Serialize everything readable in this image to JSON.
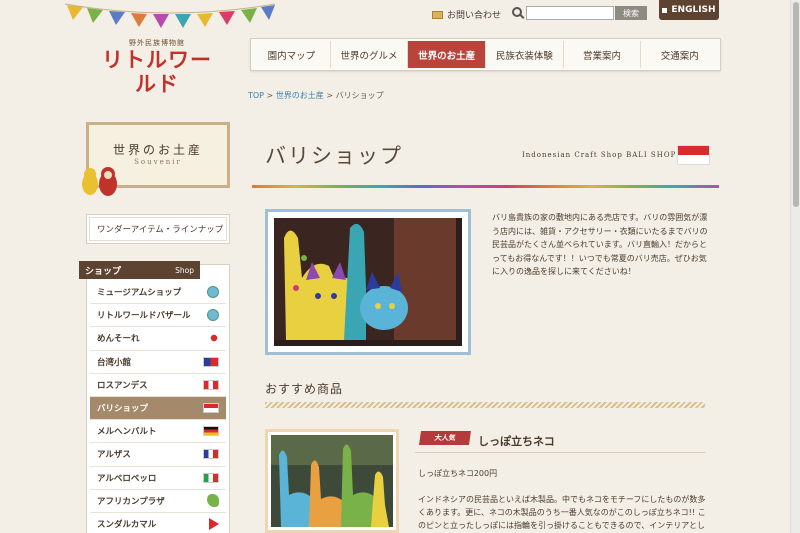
{
  "logo": {
    "sub": "野外民族博物館",
    "main": "リトルワールド"
  },
  "utility": {
    "contact_label": "お問い合わせ",
    "search_placeholder": "",
    "search_button": "検索",
    "english_label": "ENGLISH"
  },
  "nav": {
    "items": [
      {
        "label": "園内マップ"
      },
      {
        "label": "世界のグルメ"
      },
      {
        "label": "世界のお土産"
      },
      {
        "label": "民族衣装体験"
      },
      {
        "label": "営業案内"
      },
      {
        "label": "交通案内"
      }
    ],
    "active_index": 2
  },
  "breadcrumb": {
    "top": "TOP",
    "sep1": " > ",
    "parent": "世界のお土産",
    "sep2": " > ",
    "current": "バリショップ"
  },
  "sidebar": {
    "souvenir_jp": "世界のお土産",
    "souvenir_en": "Souvenir",
    "lineup_label": "ワンダーアイテム・ラインナップ",
    "shop_heading": "ショップ",
    "shop_heading_en": "Shop",
    "shops": [
      {
        "label": "ミュージアムショップ",
        "icon": "globe-icon"
      },
      {
        "label": "リトルワールドバザール",
        "icon": "globe-icon"
      },
      {
        "label": "めんそーれ",
        "icon": "flag-japan-icon"
      },
      {
        "label": "台湾小館",
        "icon": "flag-taiwan-icon"
      },
      {
        "label": "ロスアンデス",
        "icon": "flag-peru-icon"
      },
      {
        "label": "バリショップ",
        "icon": "flag-indonesia-icon",
        "active": true
      },
      {
        "label": "メルヘンバルト",
        "icon": "flag-germany-icon"
      },
      {
        "label": "アルザス",
        "icon": "flag-france-icon"
      },
      {
        "label": "アルベロベッロ",
        "icon": "flag-italy-icon"
      },
      {
        "label": "アフリカンプラザ",
        "icon": "africa-map-icon"
      },
      {
        "label": "スンダルカマル",
        "icon": "flag-nepal-icon"
      }
    ]
  },
  "main": {
    "title": "バリショップ",
    "subtitle": "Indonesian Craft Shop BALI SHOP",
    "intro": "バリ島貴族の家の敷地内にある売店です。バリの雰囲気が漂う店内には、雑貨・アクセサリー・衣類にいたるまでバリの民芸品がたくさん並べられています。バリ直輸入！だからとってもお得なんです！！いつでも常夏のバリ売店。ぜひお気に入りの逸品を探しに来てくださいね！",
    "recommended_title": "おすすめ商品",
    "product": {
      "badge": "大人気",
      "name": "しっぽ立ちネコ",
      "price": "しっぽ立ちネコ200円",
      "description": "インドネシアの民芸品といえば木製品。中でもネコをモチーフにしたものが数多くあります。更に、ネコの木製品のうち一番人気なのがこのしっぽ立ちネコ!! このピンと立ったしっぽには指輪を引っ掛けることもできるので、インテリアとしても大変オシャレ!カラー"
    }
  },
  "colors": {
    "accent_red": "#b8443c",
    "brown": "#5e4330",
    "link_blue": "#3c7fa8"
  }
}
